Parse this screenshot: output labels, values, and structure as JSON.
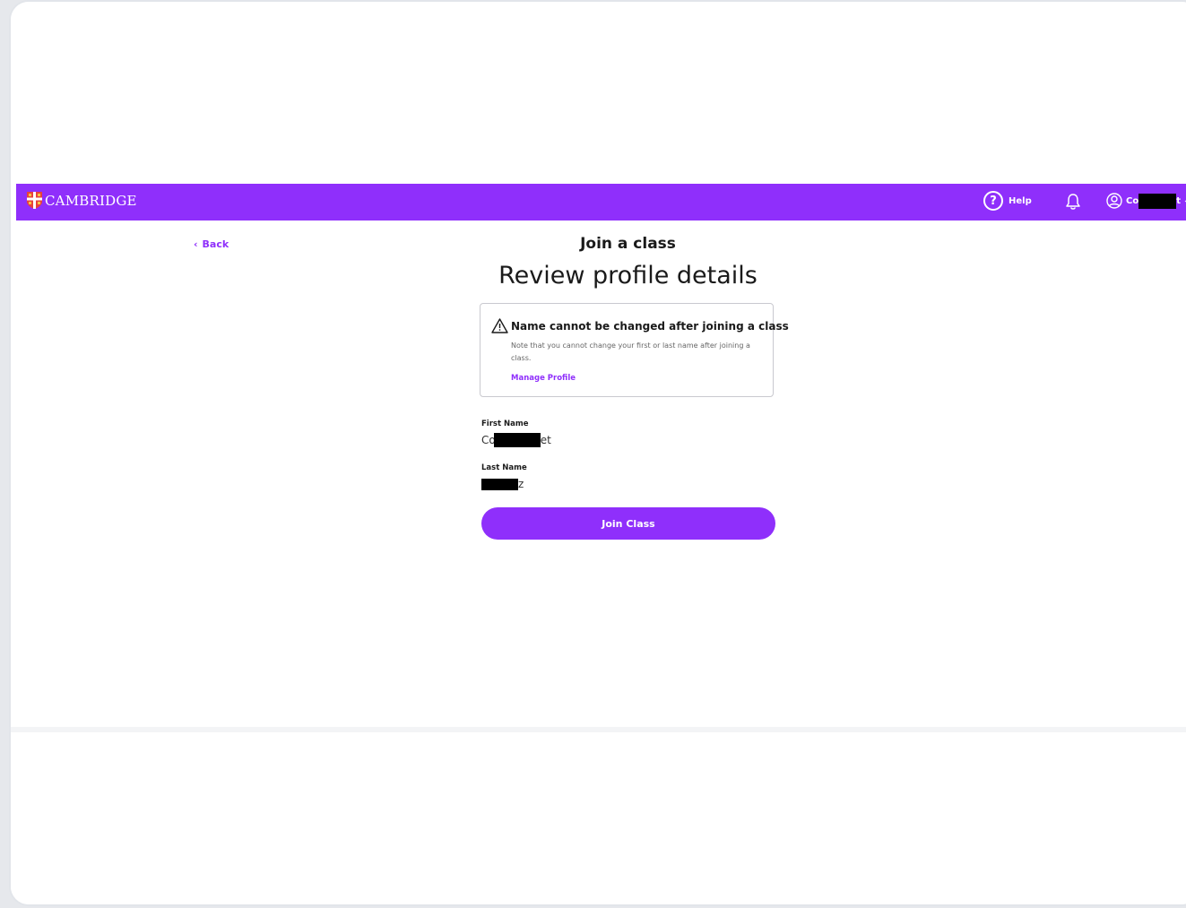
{
  "nav": {
    "brand": "CAMBRIDGE",
    "help_label": "Help",
    "user_name_prefix": "Co",
    "user_name_suffix": "t"
  },
  "page": {
    "back_label": "Back",
    "eyebrow": "Join a class",
    "title": "Review profile details"
  },
  "notice": {
    "title": "Name cannot be changed after joining a class",
    "text": "Note that you cannot change your first or last name after joining a class.",
    "link_label": "Manage Profile"
  },
  "profile": {
    "first_name_label": "First Name",
    "first_name_prefix": "Co",
    "first_name_suffix": "et",
    "last_name_label": "Last Name",
    "last_name_suffix": "z"
  },
  "actions": {
    "join_label": "Join Class"
  },
  "colors": {
    "brand_purple": "#8f2ffb"
  }
}
